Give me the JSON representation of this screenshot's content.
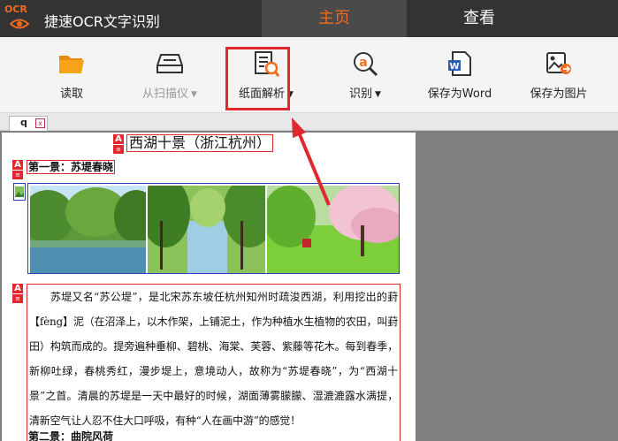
{
  "app": {
    "logo_text": "OCR",
    "title": "捷速OCR文字识别"
  },
  "tabs": [
    {
      "label": "主页",
      "active": true
    },
    {
      "label": "查看",
      "active": false
    }
  ],
  "toolbar": {
    "read": {
      "label": "读取",
      "icon": "folder-icon"
    },
    "scan": {
      "label": "从扫描仪",
      "icon": "scanner-icon",
      "disabled": true
    },
    "parse": {
      "label": "纸面解析",
      "icon": "document-analyze-icon",
      "highlighted": true
    },
    "recognize": {
      "label": "识别",
      "icon": "ocr-recognize-icon"
    },
    "save_word": {
      "label": "保存为Word",
      "icon": "word-document-icon"
    },
    "save_image": {
      "label": "保存为图片",
      "icon": "image-export-icon"
    },
    "caret": "▼"
  },
  "document_tab": {
    "label": "q",
    "close": "x"
  },
  "document": {
    "title": "西湖十景（浙江杭州）",
    "section1": "第一景：苏堤春晓",
    "paragraph": "苏堤又名“苏公堤”，是北宋苏东坡任杭州知州时疏浚西湖，利用挖出的葑【fèng】泥（在沼泽上，以木作架，上铺泥土，作为种植水生植物的农田，叫葑田）构筑而成的。提旁遍种垂柳、碧桃、海棠、芙蓉、紫藤等花木。每到春季，新柳吐绿，春桃秀红，漫步堤上，意境动人，故称为“苏堤春晓”，为“西湖十景”之首。清晨的苏堤是一天中最好的时候，湖面薄雾朦朦、湿漉漉露水满提，清新空气让人忍不住大口呼吸，有种“人在画中游”的感觉！",
    "section2": "第二景：曲院风荷"
  },
  "colors": {
    "titlebar": "#333333",
    "accent": "#f26b1d",
    "highlight": "#e0282e",
    "image_frame": "#2b3fc0",
    "workspace": "#808080"
  }
}
